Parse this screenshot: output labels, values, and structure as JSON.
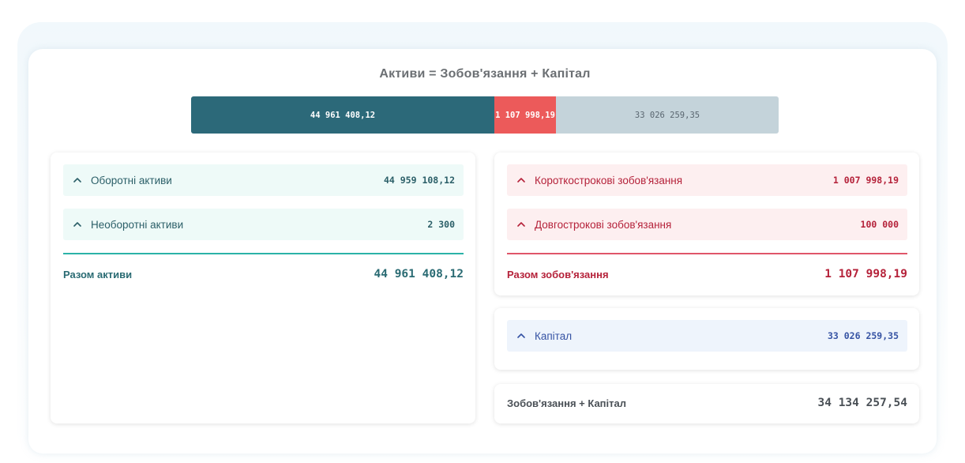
{
  "page": {
    "title": "Активи = Зобов'язання + Капітал"
  },
  "balance_bar": {
    "assets": {
      "label": "44 961 408,12",
      "value": 44961408.12,
      "color": "#2c6979"
    },
    "liabilities": {
      "label": "1 107 998,19",
      "value": 1107998.19,
      "color": "#ec5a5a"
    },
    "equity": {
      "label": "33 026 259,35",
      "value": 33026259.35,
      "color": "#c4d3da"
    }
  },
  "assets_panel": {
    "items": [
      {
        "label": "Оборотні активи",
        "value": "44 959 108,12",
        "icon": "chevron-up-icon"
      },
      {
        "label": "Необоротні активи",
        "value": "2 300",
        "icon": "chevron-up-icon"
      }
    ],
    "total_label": "Разом активи",
    "total_value": "44 961 408,12",
    "accent_color": "#2bb3a8"
  },
  "liabilities_panel": {
    "items": [
      {
        "label": "Короткострокові зобов'язання",
        "value": "1 007 998,19",
        "icon": "chevron-up-icon"
      },
      {
        "label": "Довгострокові зобов'язання",
        "value": "100 000",
        "icon": "chevron-up-icon"
      }
    ],
    "total_label": "Разом зобов'язання",
    "total_value": "1 107 998,19",
    "accent_color": "#e0566a"
  },
  "equity_panel": {
    "items": [
      {
        "label": "Капітал",
        "value": "33 026 259,35",
        "icon": "chevron-up-icon"
      }
    ],
    "accent_color": "#3552a3"
  },
  "summary_panel": {
    "label": "Зобов'язання + Капітал",
    "value": "34 134 257,54"
  }
}
